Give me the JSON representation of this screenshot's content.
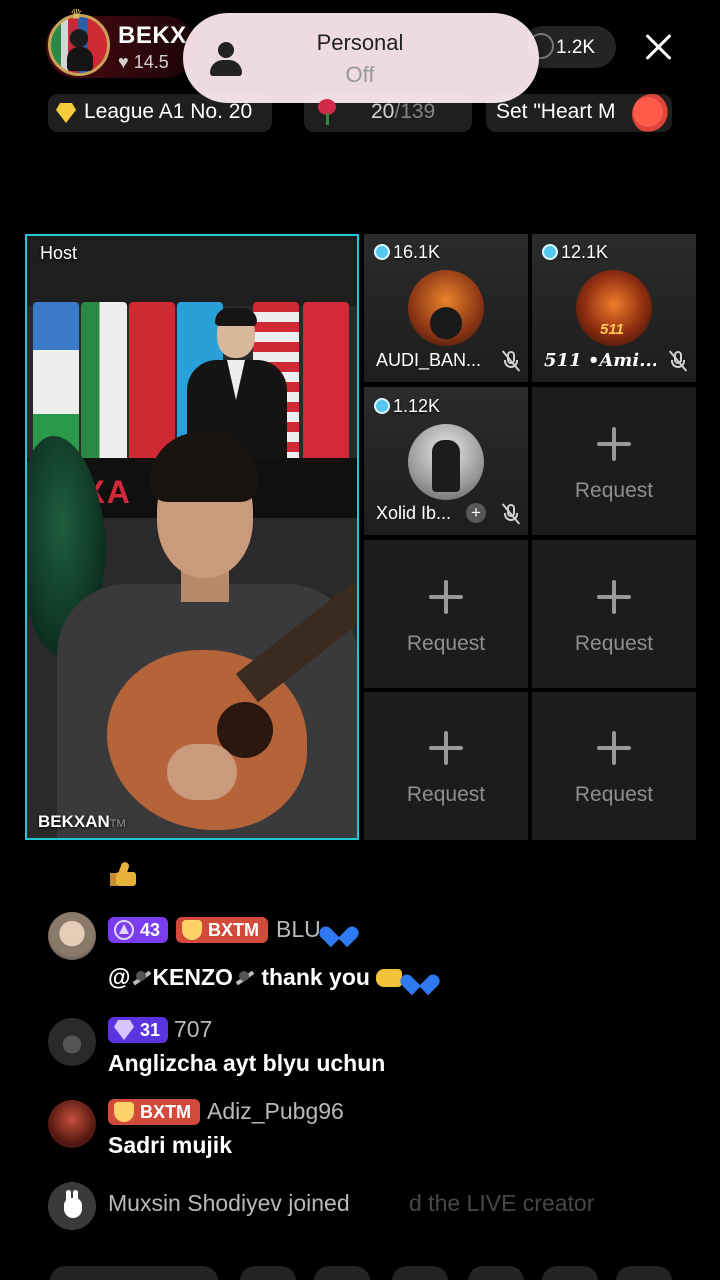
{
  "host": {
    "name": "BEKX",
    "likes": "14.5",
    "label": "Host",
    "watermark": "BEKXAN",
    "watermark_tm": "TM",
    "banner_text": "EKXA"
  },
  "viewers": {
    "count": "1.2K"
  },
  "toast": {
    "title": "Personal",
    "status": "Off"
  },
  "chips": {
    "league": "League A1 No. 20",
    "rank_current": "20",
    "rank_total": "/139",
    "heart_mission": "Set \"Heart M"
  },
  "guests": [
    {
      "score": "16.1K",
      "name": "AUDI_BAN..."
    },
    {
      "score": "12.1K",
      "name": "511 •Ami...",
      "avatar_text": "511"
    },
    {
      "score": "1.12K",
      "name": "Xolid Ib...",
      "add": "+"
    }
  ],
  "request_label": "Request",
  "chat": [
    {
      "level": "43",
      "fan_badge": "BXTM",
      "name": "BLU",
      "message_prefix": "@",
      "message_name": "KENZO",
      "message_rest": " thank you"
    },
    {
      "level": "31",
      "name": "707",
      "message": "Anglizcha ayt blyu uchun"
    },
    {
      "fan_badge": "BXTM",
      "name": "Adiz_Pubg96",
      "message": "Sadri mujik"
    }
  ],
  "join_notice": {
    "text": "Muxsin Shodiyev joined",
    "fade_text": "d the LIVE creator"
  },
  "colors": {
    "accent_cyan": "#25c6d6",
    "level_purple": "#7a3cf0",
    "fan_red": "#d24a3a"
  }
}
